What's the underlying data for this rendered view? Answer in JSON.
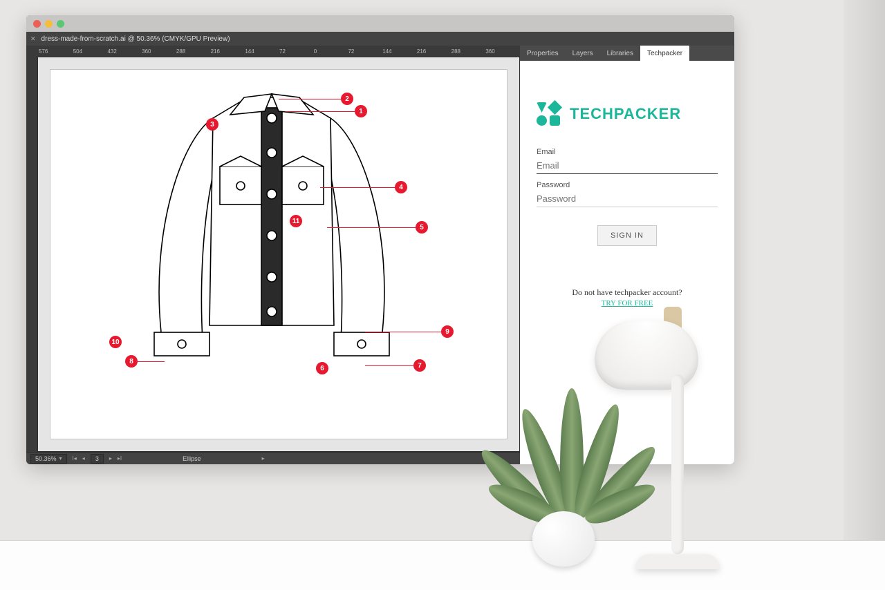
{
  "window": {
    "doc_tab": "dress-made-from-scratch.ai @ 50.36% (CMYK/GPU Preview)"
  },
  "ruler": {
    "ticks": [
      "576",
      "504",
      "432",
      "360",
      "288",
      "216",
      "144",
      "72",
      "0",
      "72",
      "144",
      "216",
      "288",
      "360"
    ]
  },
  "status": {
    "zoom": "50.36%",
    "page": "3",
    "tool": "Ellipse"
  },
  "panel_tabs": [
    "Properties",
    "Layers",
    "Libraries",
    "Techpacker"
  ],
  "techpacker": {
    "brand": "TECHPACKER",
    "email_label": "Email",
    "email_placeholder": "Email",
    "password_label": "Password",
    "password_placeholder": "Password",
    "signin": "SIGN IN",
    "signup_prompt": "Do not have techpacker account?",
    "signup_link": "TRY FOR FREE"
  },
  "callouts": [
    "1",
    "2",
    "3",
    "4",
    "5",
    "7",
    "8",
    "9",
    "10",
    "11"
  ],
  "colors": {
    "accent": "#1cb79a",
    "callout": "#e7192f"
  }
}
